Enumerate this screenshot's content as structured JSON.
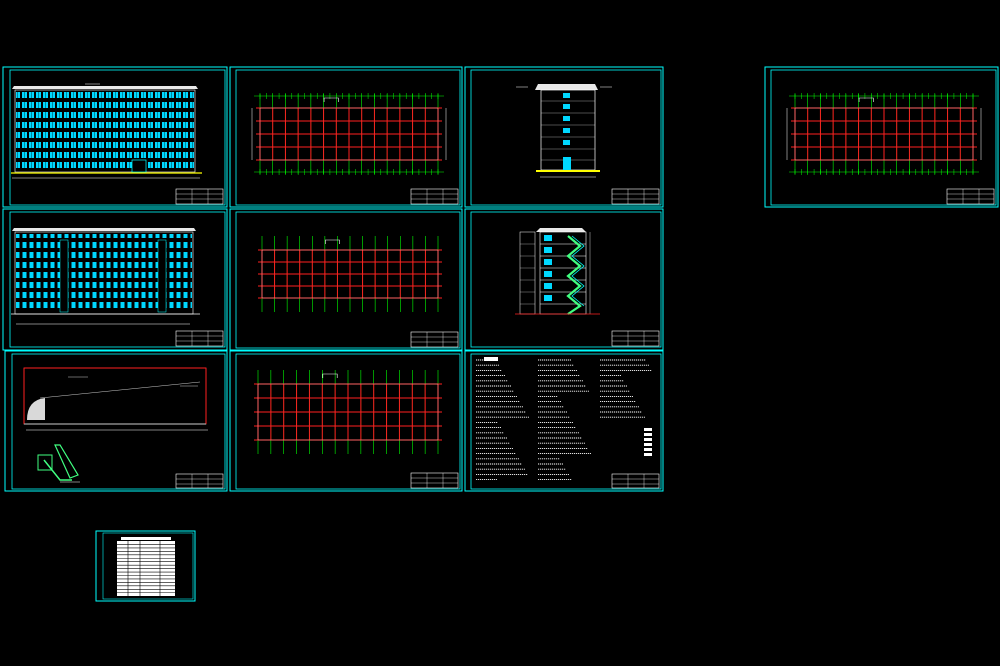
{
  "viewer": {
    "background": "#000000",
    "frame_color": "#00ffff",
    "grid_color": "#ff2020",
    "axis_color": "#00ff00",
    "window_color": "#00ffff",
    "facade_color": "#ffffff",
    "accent_color": "#ffff00",
    "stair_color": "#40ff80"
  },
  "sheets": [
    {
      "id": "north-elevation",
      "kind": "elevation"
    },
    {
      "id": "floor-plan-1",
      "kind": "plan-dims"
    },
    {
      "id": "side-elevation",
      "kind": "side-elevation"
    },
    {
      "id": "floor-plan-4",
      "kind": "plan-dims"
    },
    {
      "id": "south-elevation",
      "kind": "elevation"
    },
    {
      "id": "floor-plan-2",
      "kind": "plan-plain"
    },
    {
      "id": "section",
      "kind": "section"
    },
    {
      "id": "roof-plan",
      "kind": "roof"
    },
    {
      "id": "floor-plan-3",
      "kind": "plan-plain"
    },
    {
      "id": "design-notes",
      "kind": "notes"
    },
    {
      "id": "drawing-index",
      "kind": "index"
    }
  ]
}
